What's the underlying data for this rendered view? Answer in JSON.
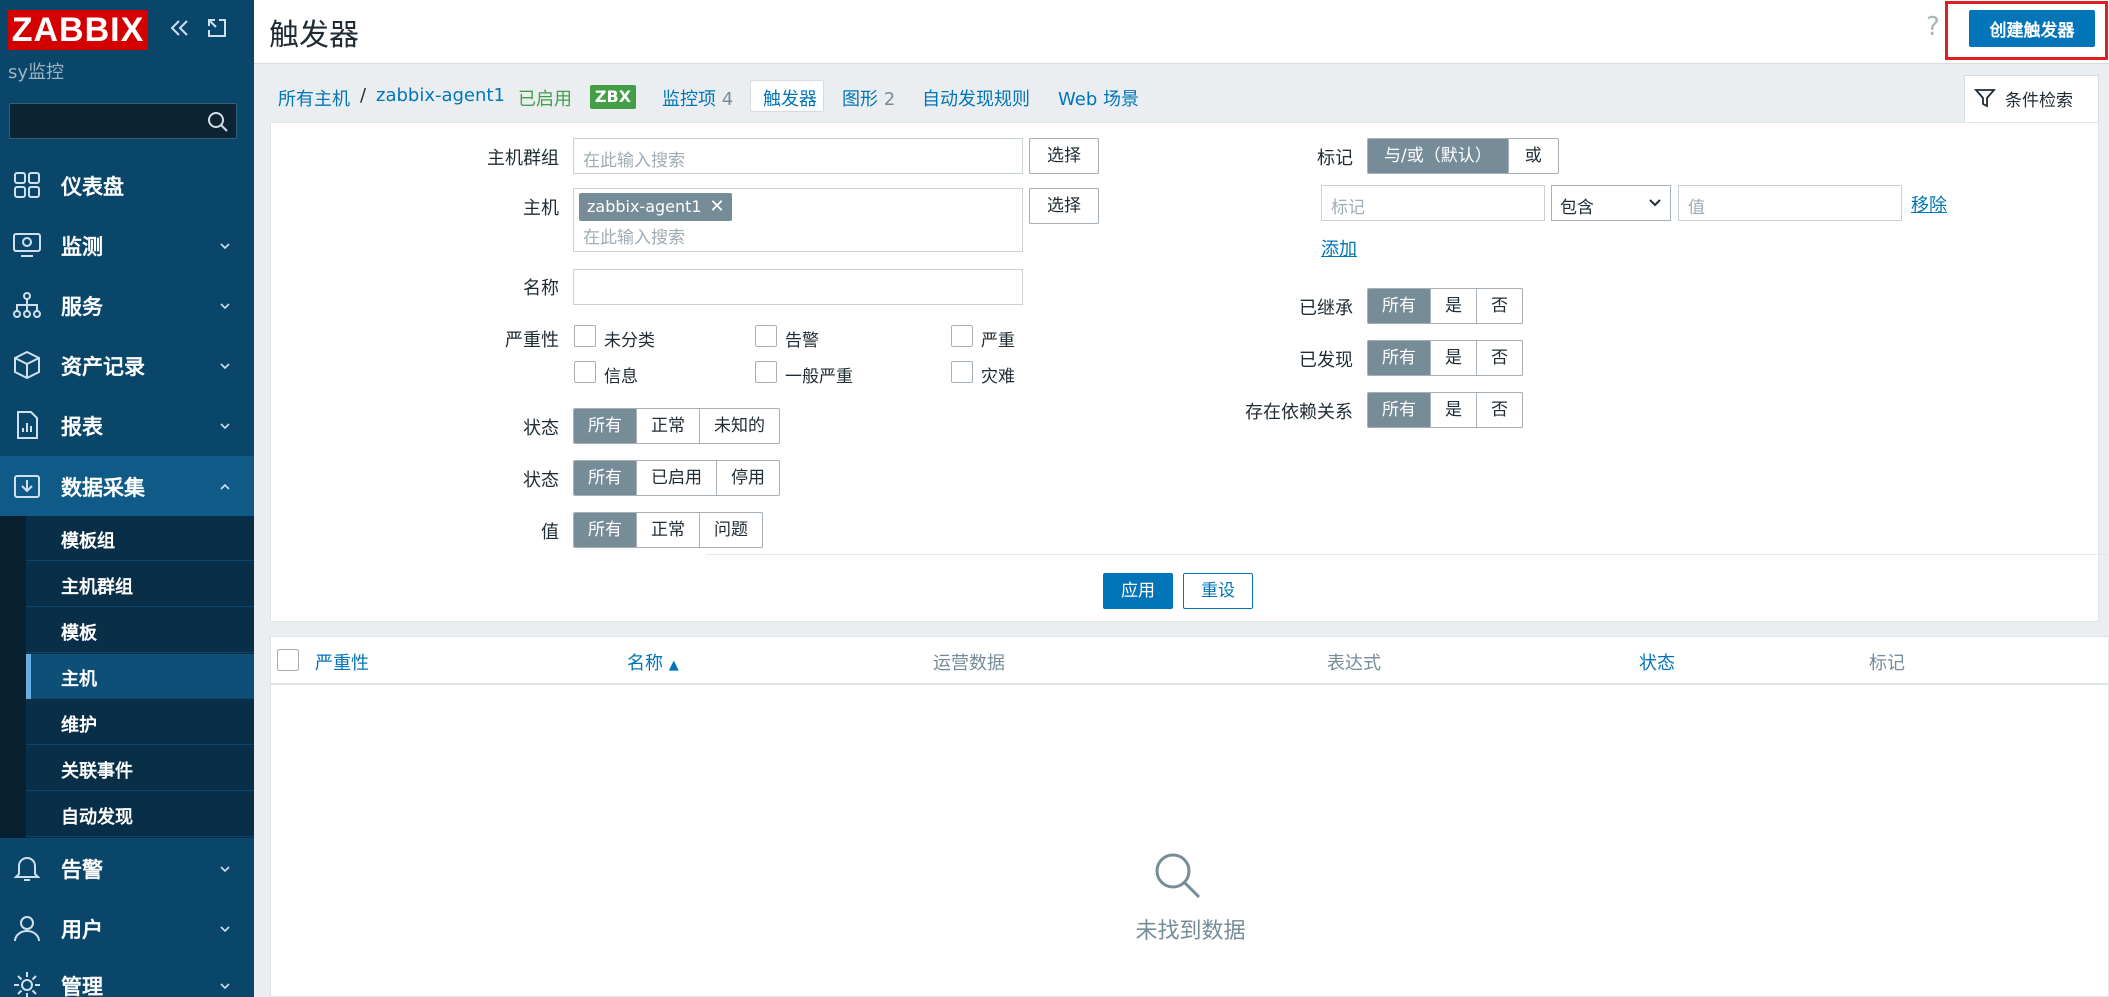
{
  "sidebar": {
    "logo": "ZABBIX",
    "site_name": "sy监控",
    "menu": [
      {
        "label": "仪表盘",
        "icon": "dashboard-icon"
      },
      {
        "label": "监测",
        "icon": "monitoring-icon"
      },
      {
        "label": "服务",
        "icon": "services-icon"
      },
      {
        "label": "资产记录",
        "icon": "inventory-icon"
      },
      {
        "label": "报表",
        "icon": "reports-icon"
      },
      {
        "label": "数据采集",
        "icon": "data-collection-icon"
      },
      {
        "label": "告警",
        "icon": "alerts-icon"
      },
      {
        "label": "用户",
        "icon": "users-icon"
      },
      {
        "label": "管理",
        "icon": "administration-icon"
      }
    ],
    "submenu": [
      "模板组",
      "主机群组",
      "模板",
      "主机",
      "维护",
      "关联事件",
      "自动发现"
    ]
  },
  "header": {
    "title": "触发器",
    "help": "?",
    "create_button": "创建触发器"
  },
  "breadcrumb": {
    "all_hosts": "所有主机",
    "separator": "/",
    "host": "zabbix-agent1",
    "enabled": "已启用",
    "zbx": "ZBX",
    "items": "监控项",
    "items_count": "4",
    "triggers": "触发器",
    "graphs": "图形",
    "graphs_count": "2",
    "discovery": "自动发现规则",
    "web": "Web 场景"
  },
  "filter": {
    "tab_label": "条件检索",
    "host_group_label": "主机群组",
    "host_group_placeholder": "在此输入搜索",
    "select_label": "选择",
    "host_label": "主机",
    "host_chip": "zabbix-agent1",
    "host_placeholder": "在此输入搜索",
    "name_label": "名称",
    "severity_label": "严重性",
    "severities": [
      "未分类",
      "告警",
      "严重",
      "信息",
      "一般严重",
      "灾难"
    ],
    "state_label": "状态",
    "state_options": [
      "所有",
      "正常",
      "未知的"
    ],
    "status_label": "状态",
    "status_options": [
      "所有",
      "已启用",
      "停用"
    ],
    "value_label": "值",
    "value_options": [
      "所有",
      "正常",
      "问题"
    ],
    "tags_label": "标记",
    "tag_ops": [
      "与/或（默认）",
      "或"
    ],
    "tag_name_placeholder": "标记",
    "tag_operator": "包含",
    "tag_value_placeholder": "值",
    "remove_link": "移除",
    "add_link": "添加",
    "inherited_label": "已继承",
    "discovered_label": "已发现",
    "dependencies_label": "存在依赖关系",
    "tri_options": [
      "所有",
      "是",
      "否"
    ],
    "apply": "应用",
    "reset": "重设"
  },
  "table": {
    "columns": [
      "严重性",
      "名称",
      "运营数据",
      "表达式",
      "状态",
      "标记"
    ],
    "sort_indicator": "▲",
    "empty_text": "未找到数据"
  }
}
